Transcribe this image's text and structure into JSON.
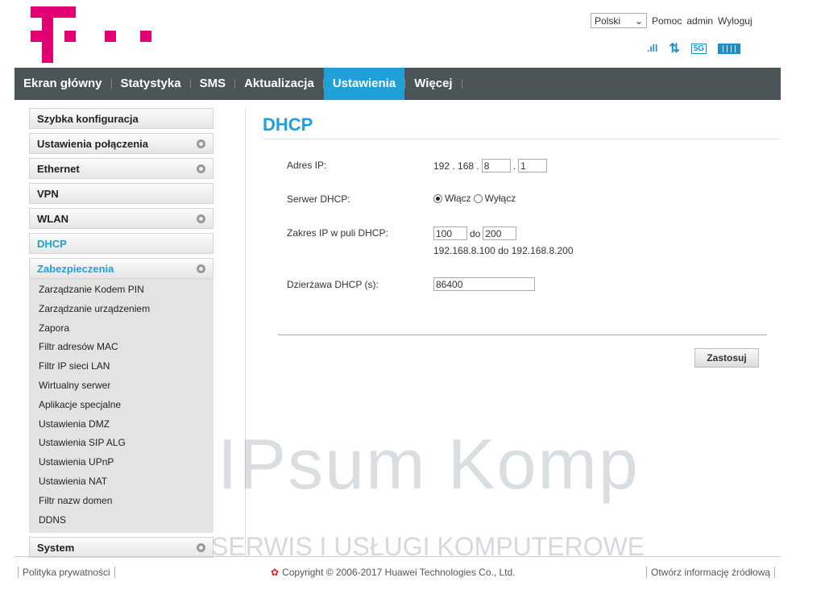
{
  "brand": {
    "color": "#e20074",
    "accent": "#1fa0d8"
  },
  "top": {
    "language": "Polski",
    "help": "Pomoc",
    "user": "admin",
    "logout": "Wyloguj"
  },
  "status_icons": [
    "signal-icon",
    "data-transfer-icon",
    "5g-icon",
    "battery-icon"
  ],
  "status_text": {
    "net": "5G"
  },
  "nav": [
    "Ekran główny",
    "Statystyka",
    "SMS",
    "Aktualizacja",
    "Ustawienia",
    "Więcej"
  ],
  "nav_active": "Ustawienia",
  "sidebar": {
    "items": [
      "Szybka konfiguracja",
      "Ustawienia połączenia",
      "Ethernet",
      "VPN",
      "WLAN",
      "DHCP",
      "Zabezpieczenia"
    ],
    "sub": [
      "Zarządzanie Kodem PIN",
      "Zarządzanie urządzeniem",
      "Zapora",
      "Filtr adresów MAC",
      "Filtr IP sieci LAN",
      "Wirtualny serwer",
      "Aplikacje specjalne",
      "Ustawienia DMZ",
      "Ustawienia SIP ALG",
      "Ustawienia UPnP",
      "Ustawienia NAT",
      "Filtr nazw domen",
      "DDNS"
    ],
    "system": "System"
  },
  "main": {
    "title": "DHCP",
    "ip_label": "Adres IP:",
    "ip_prefix": "192 . 168 .",
    "ip_third": "8",
    "ip_dot": ".",
    "ip_fourth": "1",
    "server_label": "Serwer DHCP:",
    "on": "Włącz",
    "off": "Wyłącz",
    "server_enabled": true,
    "range_label": "Zakres IP w puli DHCP:",
    "range_start": "100",
    "range_to": "do",
    "range_end": "200",
    "range_text": "192.168.8.100 do 192.168.8.200",
    "lease_label": "Dzierżawa DHCP (s):",
    "lease": "86400",
    "apply": "Zastosuj"
  },
  "footer": {
    "privacy": "Polityka prywatności",
    "copyright": "Copyright © 2006-2017 Huawei Technologies Co., Ltd.",
    "opensource": "Otwórz informację źródłową"
  },
  "watermark": {
    "line1": "IPsum Komp",
    "line2": "SERWIS I USŁUGI KOMPUTEROWE"
  }
}
